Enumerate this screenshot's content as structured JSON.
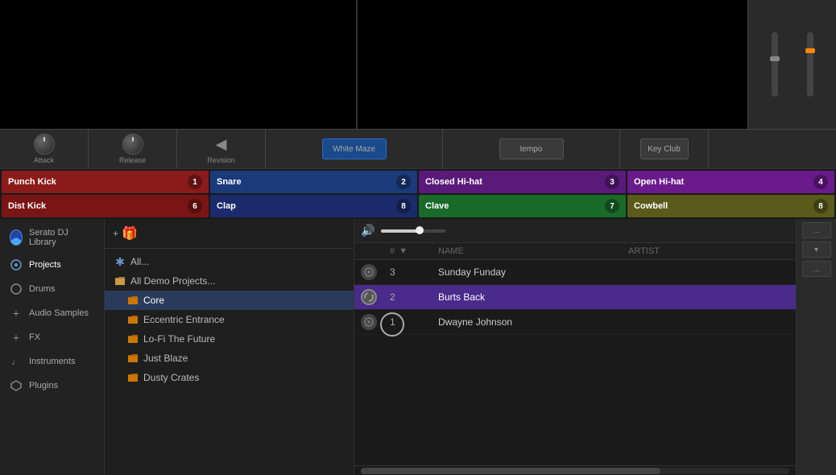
{
  "waveform": {
    "left_bg": "#000000",
    "right_bg": "#000000"
  },
  "controls": {
    "attack_label": "Attack",
    "release_label": "Release",
    "revision_label": "Revision",
    "white_maze_label": "White Maze",
    "tempo_label": "tempo",
    "key_club_label": "Key Club"
  },
  "pads": [
    {
      "name": "Punch Kick",
      "number": "1",
      "color": "pad-red"
    },
    {
      "name": "Snare",
      "number": "2",
      "color": "pad-blue"
    },
    {
      "name": "Closed Hi-hat",
      "number": "3",
      "color": "pad-purple"
    },
    {
      "name": "Open Hi-hat",
      "number": "4",
      "color": "pad-violet"
    },
    {
      "name": "Dist Kick",
      "number": "6",
      "color": "pad-dark-red"
    },
    {
      "name": "Clap",
      "number": "8",
      "color": "pad-navy"
    },
    {
      "name": "Clave",
      "number": "7",
      "color": "pad-green"
    },
    {
      "name": "Cowbell",
      "number": "8",
      "color": "pad-olive"
    }
  ],
  "sidebar": {
    "items": [
      {
        "id": "serato-library",
        "label": "Serato DJ Library",
        "icon": "⊕"
      },
      {
        "id": "projects",
        "label": "Projects",
        "icon": "◎"
      },
      {
        "id": "drums",
        "label": "Drums",
        "icon": "○"
      },
      {
        "id": "audio-samples",
        "label": "Audio Samples",
        "icon": "+"
      },
      {
        "id": "fx",
        "label": "FX",
        "icon": "+"
      },
      {
        "id": "instruments",
        "label": "Instruments",
        "icon": "♩"
      },
      {
        "id": "plugins",
        "label": "Plugins",
        "icon": "⬡"
      }
    ]
  },
  "library": {
    "add_button": "+ 🎁",
    "tree": [
      {
        "id": "all",
        "label": "All...",
        "icon": "✱",
        "indent": 0
      },
      {
        "id": "all-demo",
        "label": "All Demo Projects...",
        "icon": "folder",
        "indent": 0
      },
      {
        "id": "core",
        "label": "Core",
        "icon": "folder-orange",
        "indent": 1
      },
      {
        "id": "eccentric",
        "label": "Eccentric Entrance",
        "icon": "folder-orange",
        "indent": 1
      },
      {
        "id": "lofi",
        "label": "Lo-Fi The Future",
        "icon": "folder-orange",
        "indent": 1
      },
      {
        "id": "just-blaze",
        "label": "Just Blaze",
        "icon": "folder-orange",
        "indent": 1
      },
      {
        "id": "dusty-crates",
        "label": "Dusty Crates",
        "icon": "folder-orange",
        "indent": 1
      }
    ]
  },
  "track_list": {
    "columns": {
      "play": "",
      "number": "#",
      "name": "NAME",
      "artist": "ARTIST"
    },
    "sort_arrow": "▼",
    "tracks": [
      {
        "number": 3,
        "name": "Sunday Funday",
        "artist": "",
        "state": "normal"
      },
      {
        "number": 2,
        "name": "Burts Back",
        "artist": "",
        "state": "selected"
      },
      {
        "number": 1,
        "name": "Dwayne Johnson",
        "artist": "",
        "state": "normal"
      }
    ]
  },
  "right_panel": {
    "dots_left": "...",
    "chevron": "▾",
    "dots_right": "..."
  }
}
